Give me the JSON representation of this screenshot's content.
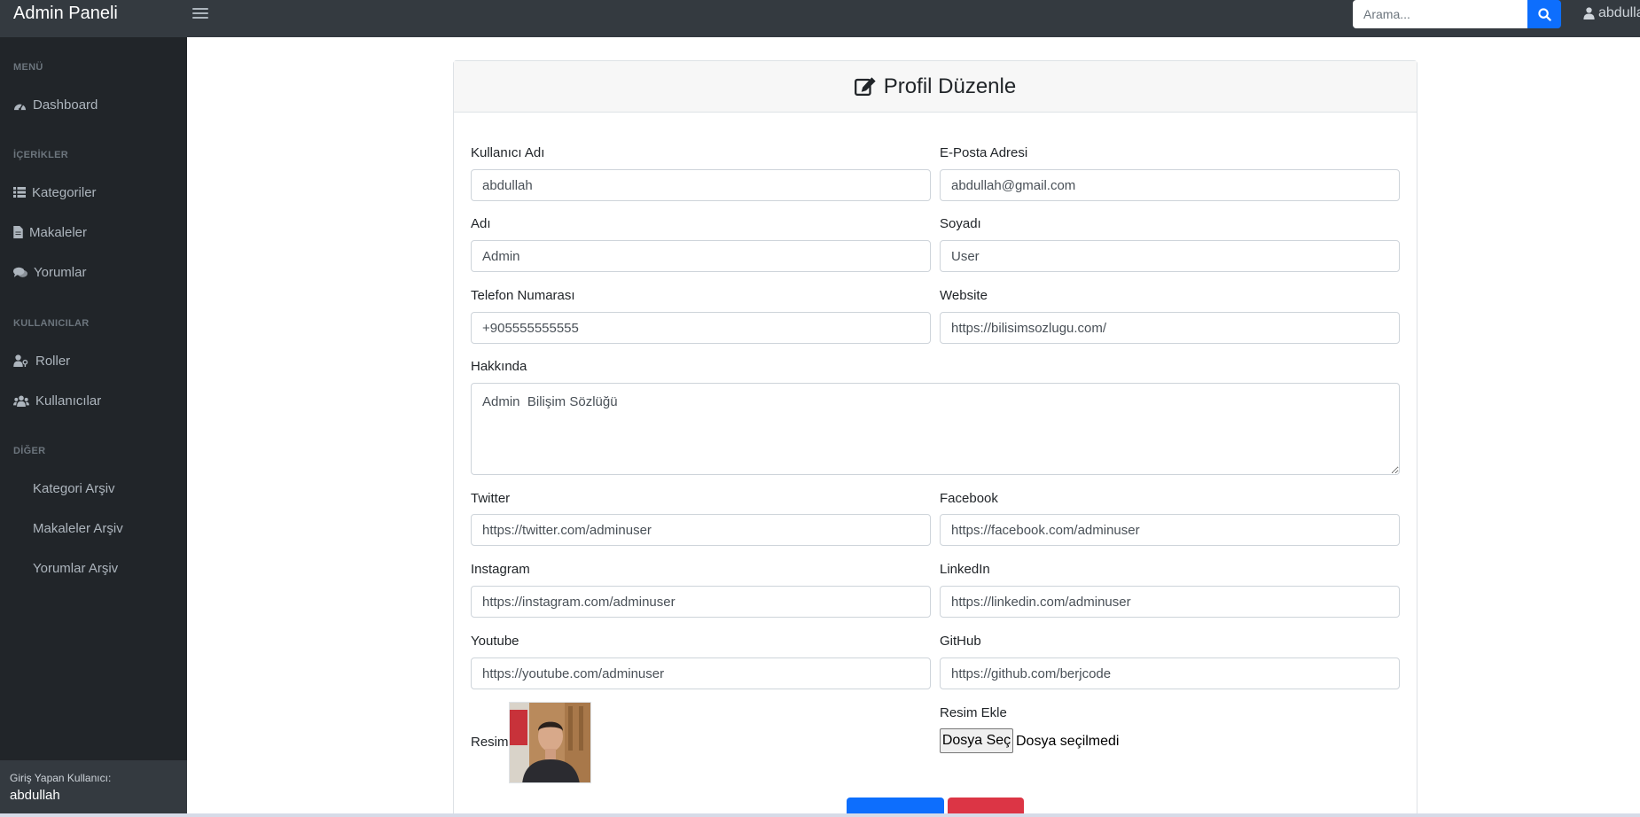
{
  "topbar": {
    "brand": "Admin Paneli",
    "search_placeholder": "Arama...",
    "user_name": "abdullah"
  },
  "sidebar": {
    "sections": [
      {
        "heading": "MENÜ",
        "items": [
          {
            "label": "Dashboard",
            "icon": "dashboard-icon"
          }
        ]
      },
      {
        "heading": "İÇERİKLER",
        "items": [
          {
            "label": "Kategoriler",
            "icon": "list-icon"
          },
          {
            "label": "Makaleler",
            "icon": "file-icon"
          },
          {
            "label": "Yorumlar",
            "icon": "comments-icon"
          }
        ]
      },
      {
        "heading": "KULLANICILAR",
        "items": [
          {
            "label": "Roller",
            "icon": "user-key-icon"
          },
          {
            "label": "Kullanıcılar",
            "icon": "users-icon"
          }
        ]
      },
      {
        "heading": "DİĞER",
        "items": [
          {
            "label": "Kategori Arşiv"
          },
          {
            "label": "Makaleler Arşiv"
          },
          {
            "label": "Yorumlar Arşiv"
          }
        ]
      }
    ],
    "footer": {
      "caption": "Giriş Yapan Kullanıcı:",
      "user": "abdullah"
    }
  },
  "form": {
    "title": "Profil Düzenle",
    "title_icon": "edit-icon",
    "username": {
      "label": "Kullanıcı Adı",
      "value": "abdullah"
    },
    "email": {
      "label": "E-Posta Adresi",
      "value": "abdullah@gmail.com"
    },
    "first_name": {
      "label": "Adı",
      "value": "Admin"
    },
    "last_name": {
      "label": "Soyadı",
      "value": "User"
    },
    "phone": {
      "label": "Telefon Numarası",
      "value": "+905555555555"
    },
    "website": {
      "label": "Website",
      "value": "https://bilisimsozlugu.com/"
    },
    "about": {
      "label": "Hakkında",
      "value": "Admin  Bilişim Sözlüğü"
    },
    "twitter": {
      "label": "Twitter",
      "value": "https://twitter.com/adminuser"
    },
    "facebook": {
      "label": "Facebook",
      "value": "https://facebook.com/adminuser"
    },
    "instagram": {
      "label": "Instagram",
      "value": "https://instagram.com/adminuser"
    },
    "linkedin": {
      "label": "LinkedIn",
      "value": "https://linkedin.com/adminuser"
    },
    "youtube": {
      "label": "Youtube",
      "value": "https://youtube.com/adminuser"
    },
    "github": {
      "label": "GitHub",
      "value": "https://github.com/berjcode"
    },
    "picture": {
      "label": "Resim"
    },
    "picture_upload": {
      "label": "Resim Ekle",
      "button": "Dosya Seç",
      "status": "Dosya seçilmedi"
    }
  },
  "colors": {
    "topbar": "#343a40",
    "sidebar": "#212529",
    "primary": "#0d6efd",
    "danger": "#dc3545"
  }
}
